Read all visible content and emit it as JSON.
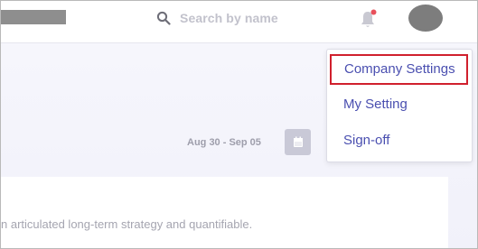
{
  "header": {
    "search": {
      "placeholder": "Search by name",
      "icon": "search-icon"
    },
    "notification": {
      "icon": "bell-icon",
      "has_unread": true,
      "badge_color": "#e8505b"
    },
    "avatar": {
      "icon": "user-avatar"
    }
  },
  "main": {
    "date_range": "Aug 30 - Sep 05",
    "calendar_icon": "calendar-icon",
    "card_text": "n articulated long-term strategy and quantifiable."
  },
  "user_menu": {
    "items": [
      {
        "label": "Company Settings",
        "highlighted": true
      },
      {
        "label": "My Setting",
        "highlighted": false
      },
      {
        "label": "Sign-off",
        "highlighted": false
      }
    ]
  },
  "colors": {
    "menu_text": "#4a4fb0",
    "highlight_border": "#d0202d",
    "muted_text": "#9e9eab",
    "calendar_button": "#c9c9d7"
  }
}
